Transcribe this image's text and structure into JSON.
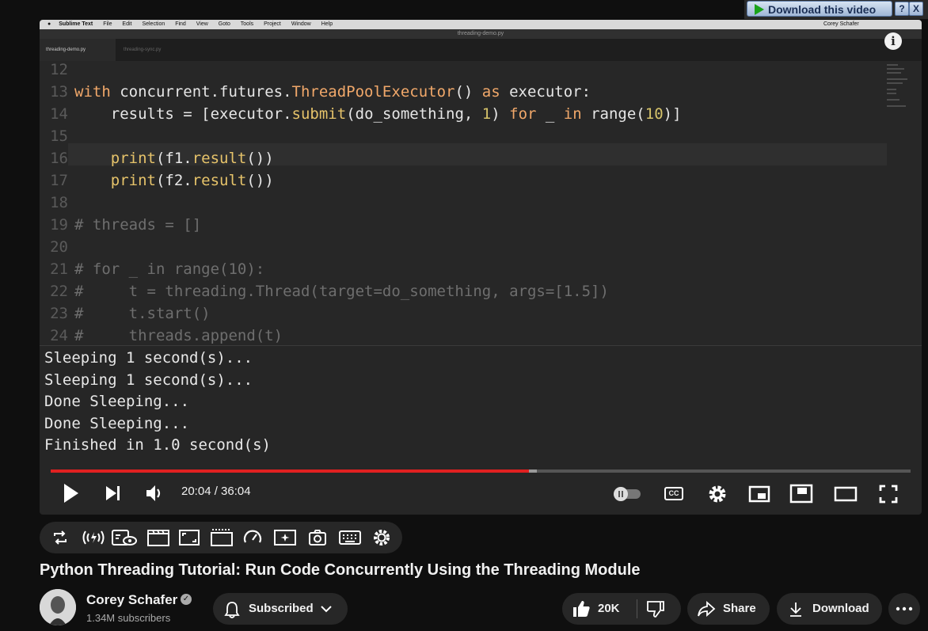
{
  "download_bar": {
    "label": "Download this video",
    "help": "?",
    "close": "X"
  },
  "video": {
    "menubar": [
      "Sublime Text",
      "File",
      "Edit",
      "Selection",
      "Find",
      "View",
      "Goto",
      "Tools",
      "Project",
      "Window",
      "Help"
    ],
    "menubar_user": "Corey Schafer",
    "window_title": "threading-demo.py",
    "tabs": [
      "threading-demo.py",
      "threading-sync.py"
    ],
    "line_numbers": [
      "12",
      "13",
      "14",
      "15",
      "16",
      "17",
      "18",
      "19",
      "20",
      "21",
      "22",
      "23",
      "24"
    ],
    "code": {
      "l13_with": "with",
      "l13_a": " concurrent.futures.",
      "l13_cls": "ThreadPoolExecutor",
      "l13_b": "() ",
      "l13_as": "as",
      "l13_c": " executor:",
      "l14_a": "    results = [executor.",
      "l14_fn": "submit",
      "l14_b": "(do_something, ",
      "l14_n1": "1",
      "l14_c": ") ",
      "l14_for": "for",
      "l14_d": " _ ",
      "l14_in": "in",
      "l14_e": " range(",
      "l14_n2": "10",
      "l14_f": ")]",
      "l16_fn": "    print",
      "l16_a": "(f1.",
      "l16_res": "result",
      "l16_b": "())",
      "l17_fn": "    print",
      "l17_a": "(f2.",
      "l17_res": "result",
      "l17_b": "())",
      "l19": "# threads = []",
      "l21": "# for _ in range(10):",
      "l22": "#     t = threading.Thread(target=do_something, args=[1.5])",
      "l23": "#     t.start()",
      "l24": "#     threads.append(t)"
    },
    "console": [
      "Sleeping 1 second(s)...",
      "Sleeping 1 second(s)...",
      "Done Sleeping...",
      "Done Sleeping...",
      "Finished in 1.0 second(s)"
    ],
    "info": "i",
    "time": "20:04 / 36:04",
    "progress_fraction": 0.556,
    "cc_label": "CC"
  },
  "video_title": "Python Threading Tutorial: Run Code Concurrently Using the Threading Module",
  "channel": {
    "name": "Corey Schafer",
    "subscribers": "1.34M subscribers"
  },
  "actions": {
    "subscribed": "Subscribed",
    "likes": "20K",
    "share": "Share",
    "download": "Download"
  }
}
